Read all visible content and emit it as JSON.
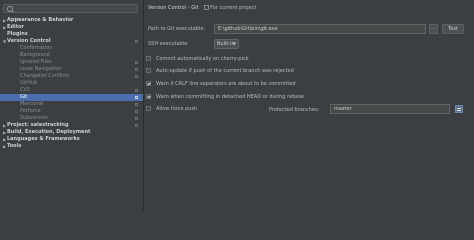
{
  "search": {
    "placeholder": ""
  },
  "tree": [
    {
      "label": "Appearance & Behavior",
      "level": 0,
      "arrow": "▶",
      "project": false,
      "selected": false
    },
    {
      "label": "Editor",
      "level": 0,
      "arrow": "▶",
      "project": false,
      "selected": false
    },
    {
      "label": "Plugins",
      "level": 0,
      "arrow": "",
      "project": false,
      "selected": false
    },
    {
      "label": "Version Control",
      "level": 0,
      "arrow": "▼",
      "project": true,
      "selected": false
    },
    {
      "label": "Confirmation",
      "level": 1,
      "arrow": "",
      "project": false,
      "selected": false
    },
    {
      "label": "Background",
      "level": 1,
      "arrow": "",
      "project": false,
      "selected": false
    },
    {
      "label": "Ignored Files",
      "level": 1,
      "arrow": "",
      "project": true,
      "selected": false
    },
    {
      "label": "Issue Navigation",
      "level": 1,
      "arrow": "",
      "project": true,
      "selected": false
    },
    {
      "label": "Changelist Conflicts",
      "level": 1,
      "arrow": "",
      "project": true,
      "selected": false
    },
    {
      "label": "GitHub",
      "level": 1,
      "arrow": "",
      "project": false,
      "selected": false
    },
    {
      "label": "CVS",
      "level": 1,
      "arrow": "",
      "project": true,
      "selected": false
    },
    {
      "label": "Git",
      "level": 1,
      "arrow": "",
      "project": true,
      "selected": true
    },
    {
      "label": "Mercurial",
      "level": 1,
      "arrow": "",
      "project": true,
      "selected": false
    },
    {
      "label": "Perforce",
      "level": 1,
      "arrow": "",
      "project": true,
      "selected": false
    },
    {
      "label": "Subversion",
      "level": 1,
      "arrow": "",
      "project": true,
      "selected": false
    },
    {
      "label": "Project: salestracking",
      "level": 0,
      "arrow": "▶",
      "project": true,
      "selected": false
    },
    {
      "label": "Build, Execution, Deployment",
      "level": 0,
      "arrow": "▶",
      "project": false,
      "selected": false
    },
    {
      "label": "Languages & Frameworks",
      "level": 0,
      "arrow": "▶",
      "project": false,
      "selected": false
    },
    {
      "label": "Tools",
      "level": 0,
      "arrow": "▶",
      "project": false,
      "selected": false
    }
  ],
  "breadcrumb": {
    "part1": "Version Control",
    "separator": "›",
    "part2": "Git",
    "for_project": "For current project"
  },
  "form": {
    "git_path_label": "Path to Git executable:",
    "git_path_value": "E:\\github\\Git\\bin\\git.exe",
    "browse_label": "...",
    "test_label": "Test",
    "ssh_label": "SSH executable:",
    "ssh_value": "Built-in"
  },
  "checkboxes": [
    {
      "label": "Commit automatically on cherry-pick",
      "checked": false
    },
    {
      "label": "Auto-update if push of the current branch was rejected",
      "checked": false
    },
    {
      "label": "Warn if CRLF line separators are about to be committed",
      "checked": true
    },
    {
      "label": "Warn when committing in detached HEAD or during rebase",
      "checked": true
    },
    {
      "label": "Allow force push",
      "checked": false
    }
  ],
  "protected": {
    "label": "Protected branches:",
    "value": "master"
  }
}
